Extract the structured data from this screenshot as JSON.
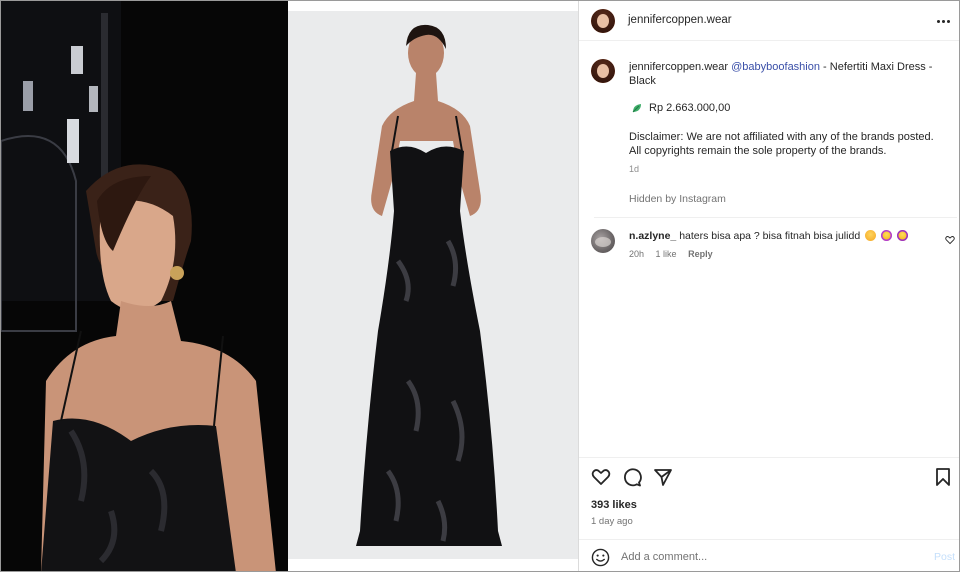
{
  "post": {
    "username": "jennifercoppen.wear",
    "more_icon": "more-horizontal-icon"
  },
  "caption": {
    "username": "jennifercoppen.wear",
    "mention": "@babyboofashion",
    "text": " - Nefertiti Maxi Dress - Black",
    "price_icon": "leaf-icon",
    "price": "Rp 2.663.000,00",
    "disclaimer_line1": "Disclaimer: We are not affiliated with any of the brands posted.",
    "disclaimer_line2": "All copyrights remain the sole property of the brands.",
    "time": "1d",
    "hidden_notice": "Hidden by Instagram"
  },
  "comments": [
    {
      "username": "n.azlyne_",
      "text": "haters bisa apa ? bisa fitnah bisa julidd",
      "emojis": [
        "hug-emoji",
        "star-struck-emoji",
        "partying-emoji"
      ],
      "time": "20h",
      "likes": "1 like",
      "reply_label": "Reply"
    }
  ],
  "actions": {
    "icons": [
      "heart-icon",
      "comment-icon",
      "share-icon",
      "bookmark-icon"
    ],
    "likes": "393 likes",
    "posted": "1 day ago"
  },
  "add_comment": {
    "placeholder": "Add a comment...",
    "post_label": "Post"
  },
  "colors": {
    "mention": "#3a4fa8",
    "muted": "#737373",
    "post_disabled": "#c4dffb"
  }
}
